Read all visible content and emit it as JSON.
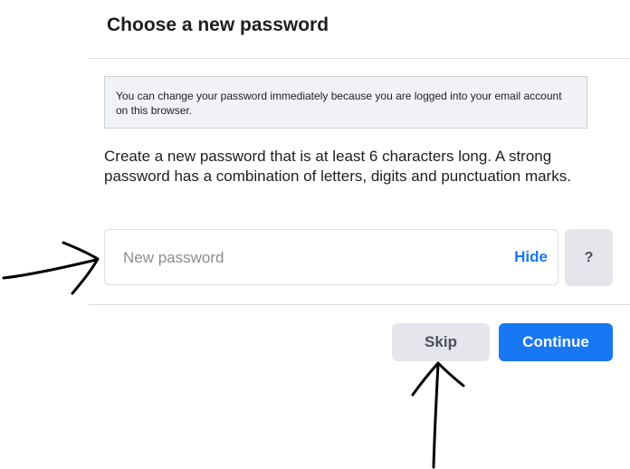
{
  "dialog": {
    "title": "Choose a new password",
    "notice": "You can change your password immediately because you are logged into your email account on this browser.",
    "instructions": "Create a new password that is at least 6 characters long. A strong password has a combination of letters, digits and punctuation marks.",
    "password_field": {
      "value": "",
      "placeholder": "New password",
      "toggle_label": "Hide"
    },
    "help_label": "?",
    "buttons": {
      "skip_label": "Skip",
      "continue_label": "Continue"
    }
  },
  "colors": {
    "accent": "#1877f2",
    "secondary_button": "#e4e6eb",
    "notice_background": "#f0f2f5",
    "annotation_ink": "#000000"
  }
}
